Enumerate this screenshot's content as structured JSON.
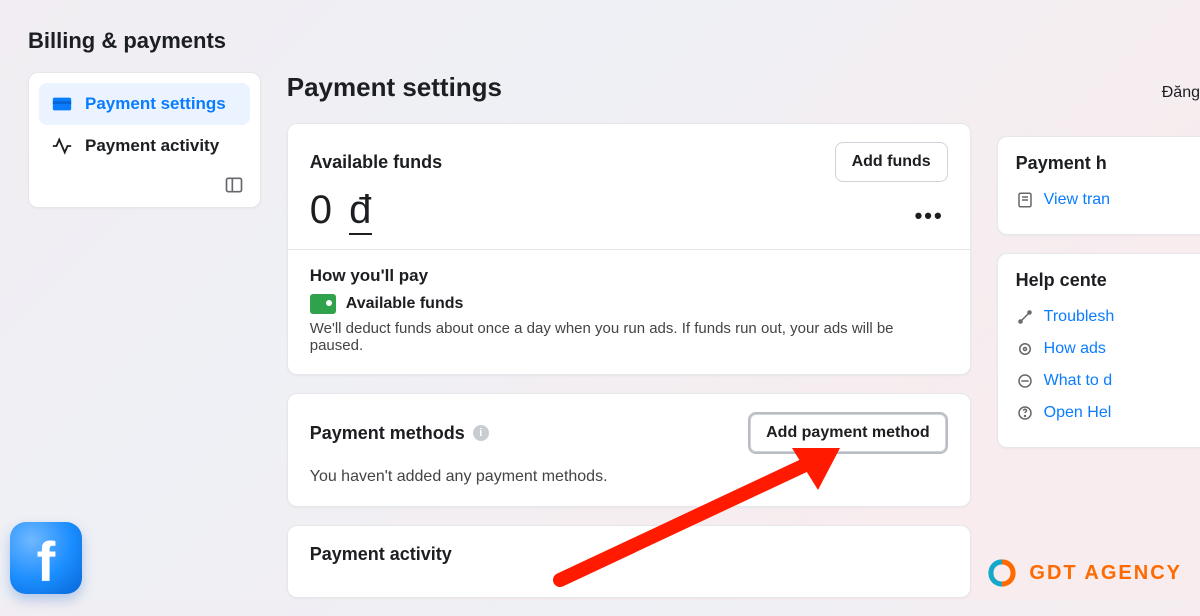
{
  "page_title": "Billing & payments",
  "sidebar": {
    "items": [
      {
        "label": "Payment settings",
        "icon": "credit-card-icon",
        "active": true
      },
      {
        "label": "Payment activity",
        "icon": "activity-icon",
        "active": false
      }
    ]
  },
  "main": {
    "title": "Payment settings",
    "header_button_cut": "Đăng",
    "available_funds": {
      "label": "Available funds",
      "add_funds_label": "Add funds",
      "amount_value": "0",
      "amount_currency": "đ",
      "how_pay_label": "How you'll pay",
      "mode_label": "Available funds",
      "mode_desc": "We'll deduct funds about once a day when you run ads. If funds run out, your ads will be paused."
    },
    "payment_methods": {
      "title": "Payment methods",
      "add_label": "Add payment method",
      "empty_text": "You haven't added any payment methods."
    },
    "payment_activity": {
      "title": "Payment activity"
    }
  },
  "right": {
    "history": {
      "title": "Payment h",
      "link_label": "View tran"
    },
    "help": {
      "title": "Help cente",
      "links": [
        {
          "icon": "tools-icon",
          "label": "Troublesh"
        },
        {
          "icon": "gear-lock-icon",
          "label": "How ads"
        },
        {
          "icon": "no-entry-icon",
          "label": "What to d"
        },
        {
          "icon": "question-icon",
          "label": "Open Hel"
        }
      ]
    }
  },
  "overlays": {
    "fb_badge": "f",
    "gdt_text": "GDT AGENCY"
  }
}
